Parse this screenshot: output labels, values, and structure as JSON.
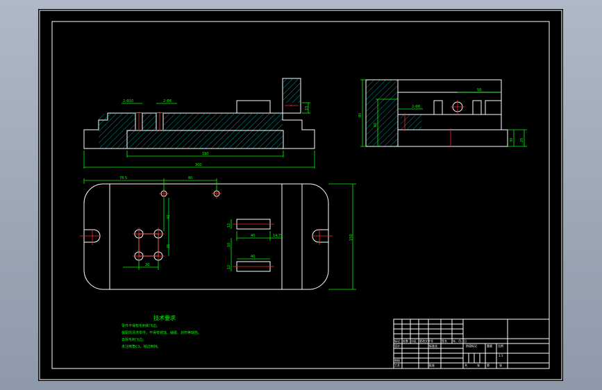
{
  "colors": {
    "background": "#000000",
    "outline": "#ffffff",
    "dimension": "#00ff00",
    "centerline": "#ff2a2a",
    "hatch": "#00ffff",
    "window_frame": "#9aa6b6"
  },
  "front_view": {
    "dim_hole_left": "2-Φ10",
    "dim_hole_right": "2-Φ8",
    "dim_inner_width": "190",
    "dim_overall_width": "300",
    "dim_pin_height": "15"
  },
  "plan_view": {
    "dim_left_offset": "78.5",
    "dim_hole_spacing": "80",
    "dim_vertical_a": "40",
    "dim_vertical_b": "35",
    "dim_square": "30",
    "dim_slot_width": "40",
    "dim_slot_offset": "14.75",
    "dim_slot_length": "40",
    "dim_slot_height": "12",
    "dim_side_a": "10",
    "dim_side_b": "12",
    "dim_overall_height": "150"
  },
  "side_view": {
    "dim_top_width": "50",
    "dim_hole": "2-Φ8",
    "dim_overall_height": "80",
    "dim_mid_height": "60",
    "dim_step_a": "30",
    "dim_step_b": "25"
  },
  "notes": {
    "title": "技术要求",
    "lines": [
      "零件不得有毛刺和飞边。",
      "装配前清洗零件，不得有锈蚀、磕碰、划伤等缺陷。",
      "去除毛刺飞边。",
      "未注倒角C1，锐边倒钝。"
    ]
  },
  "title_block": {
    "rev_cells": [
      "标记",
      "处数",
      "分区",
      "更改文件号",
      "签名",
      "年、月、日"
    ],
    "design_label": "设计",
    "standard_label": "标准化",
    "review_label": "审核",
    "process_label": "工艺",
    "approve_label": "批准",
    "stage_label": "阶段标记",
    "weight_label": "重量",
    "scale_label": "比例",
    "scale_value": "1:1",
    "sheet_total": "共",
    "sheet_label": "张",
    "sheet_no": "第",
    "sheet_label2": "张"
  }
}
